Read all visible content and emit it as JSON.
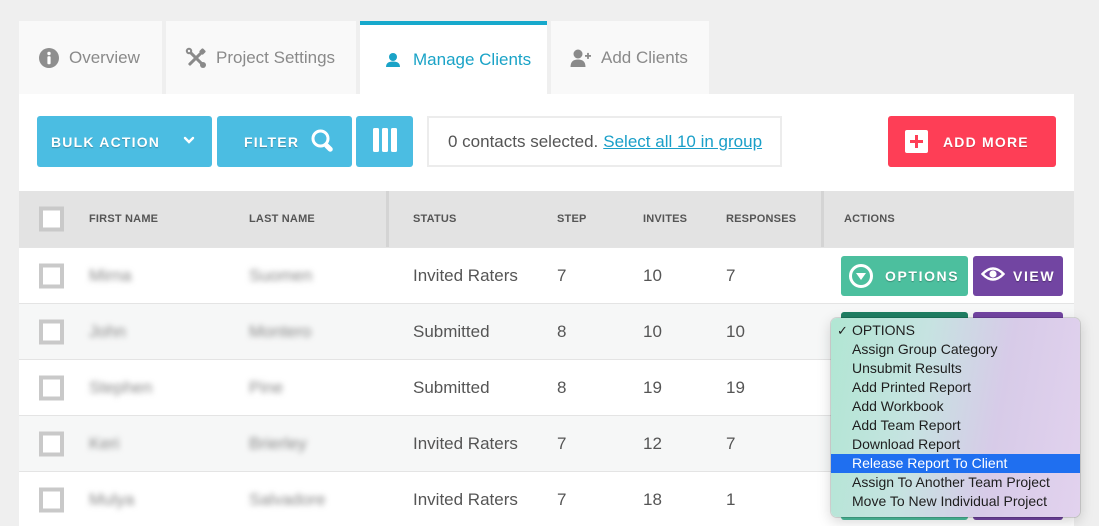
{
  "tabs": [
    {
      "label": "Overview",
      "icon": "info-icon",
      "active": false
    },
    {
      "label": "Project Settings",
      "icon": "tools-icon",
      "active": false
    },
    {
      "label": "Manage Clients",
      "icon": "user-icon",
      "active": true
    },
    {
      "label": "Add Clients",
      "icon": "add-user-icon",
      "active": false
    }
  ],
  "toolbar": {
    "bulk_action_label": "BULK ACTION",
    "filter_label": "FILTER",
    "selection_text": "0 contacts selected.",
    "select_all_link": "Select all 10 in group",
    "add_more_label": "ADD MORE"
  },
  "table": {
    "columns": [
      "FIRST NAME",
      "LAST NAME",
      "STATUS",
      "STEP",
      "INVITES",
      "RESPONSES",
      "ACTIONS"
    ],
    "rows": [
      {
        "first": "Mirna",
        "last": "Suomen",
        "status": "Invited Raters",
        "step": "7",
        "invites": "10",
        "responses": "7"
      },
      {
        "first": "John",
        "last": "Montero",
        "status": "Submitted",
        "step": "8",
        "invites": "10",
        "responses": "10"
      },
      {
        "first": "Stephen",
        "last": "Pine",
        "status": "Submitted",
        "step": "8",
        "invites": "19",
        "responses": "19"
      },
      {
        "first": "Keri",
        "last": "Brierley",
        "status": "Invited Raters",
        "step": "7",
        "invites": "12",
        "responses": "7"
      },
      {
        "first": "Mulya",
        "last": "Salvadore",
        "status": "Invited Raters",
        "step": "7",
        "invites": "18",
        "responses": "1"
      }
    ],
    "options_label": "OPTIONS",
    "view_label": "VIEW"
  },
  "options_menu": {
    "check_glyph": "✓",
    "selected_index": 0,
    "highlighted_index": 7,
    "items": [
      "OPTIONS",
      "Assign Group Category",
      "Unsubmit Results",
      "Add Printed Report",
      "Add Workbook",
      "Add Team Report",
      "Download Report",
      "Release Report To Client",
      "Assign To Another Team Project",
      "Move To New Individual Project"
    ]
  },
  "colors": {
    "accent": "#17a9cc",
    "toolbar_button": "#4bbde2",
    "add_button": "#fe3e56",
    "options_button": "#4cbf9e",
    "view_button": "#7245a2",
    "menu_highlight": "#1f6ff0"
  }
}
